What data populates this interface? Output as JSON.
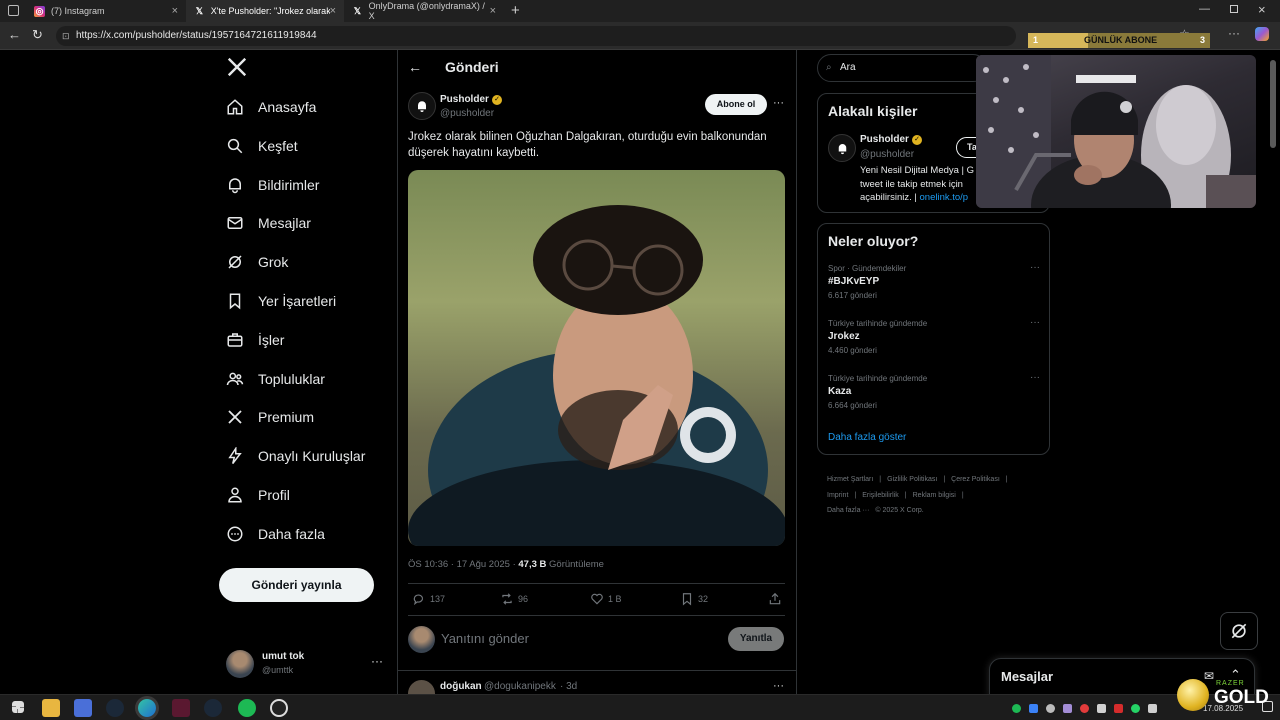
{
  "browser": {
    "tabs": [
      {
        "title": "(7) Instagram",
        "active": false
      },
      {
        "title": "X'te Pusholder: \"Jrokez olarak bili",
        "active": true
      },
      {
        "title": "OnlyDrama (@onlydramaX) / X",
        "active": false
      }
    ],
    "url": "https://x.com/pusholder/status/1957164721611919844"
  },
  "overlay": {
    "sub_goal_left": "1",
    "sub_goal_label": "GÜNLÜK ABONE",
    "sub_goal_right": "3",
    "sub_progress": 0.33,
    "gold_label": "GOLD",
    "razer_label": "RAZER"
  },
  "sidebar": {
    "items": [
      {
        "label": "Anasayfa",
        "icon": "home-icon"
      },
      {
        "label": "Keşfet",
        "icon": "search-icon"
      },
      {
        "label": "Bildirimler",
        "icon": "bell-icon"
      },
      {
        "label": "Mesajlar",
        "icon": "mail-icon"
      },
      {
        "label": "Grok",
        "icon": "grok-icon"
      },
      {
        "label": "Yer İşaretleri",
        "icon": "bookmark-icon"
      },
      {
        "label": "İşler",
        "icon": "briefcase-icon"
      },
      {
        "label": "Topluluklar",
        "icon": "people-icon"
      },
      {
        "label": "Premium",
        "icon": "x-logo-icon"
      },
      {
        "label": "Onaylı Kuruluşlar",
        "icon": "lightning-icon"
      },
      {
        "label": "Profil",
        "icon": "person-icon"
      },
      {
        "label": "Daha fazla",
        "icon": "more-circle-icon"
      }
    ],
    "post_button": "Gönderi yayınla",
    "account": {
      "name": "umut tok",
      "handle": "@umttk"
    }
  },
  "main": {
    "header_title": "Gönderi",
    "post": {
      "author_name": "Pusholder",
      "author_handle": "@pusholder",
      "follow_label": "Abone ol",
      "text": "Jrokez olarak bilinen Oğuzhan Dalgakıran, oturduğu evin balkonundan düşerek hayatını kaybetti.",
      "timestamp": "ÖS 10:36 · 17 Ağu 2025 · ",
      "views_value": "47,3 B",
      "views_label": " Görüntüleme",
      "replies": "137",
      "reposts": "96",
      "likes": "1 B",
      "bookmarks": "32"
    },
    "reply_box": {
      "placeholder": "Yanıtını gönder",
      "button": "Yanıtla"
    },
    "next_reply": {
      "name": "doğukan",
      "handle": "@dogukanipekk",
      "time": "· 3d"
    }
  },
  "right": {
    "search_placeholder": "Ara",
    "related_title": "Alakalı kişiler",
    "related": {
      "name": "Pusholder",
      "handle": "@pusholder",
      "button": "Ta",
      "bio_line1": "Yeni Nesil Dijital Medya | G",
      "bio_line2": "tweet ile takip etmek için",
      "bio_line3": "açabilirsiniz. | ",
      "bio_link": "onelink.to/p"
    },
    "trends_title": "Neler oluyor?",
    "trends": [
      {
        "category": "Spor · Gündemdekiler",
        "name": "#BJKvEYP",
        "count": "6.617 gönderi"
      },
      {
        "category": "Türkiye tarihinde gündemde",
        "name": "Jrokez",
        "count": "4.460 gönderi"
      },
      {
        "category": "Türkiye tarihinde gündemde",
        "name": "Kaza",
        "count": "6.664 gönderi"
      }
    ],
    "show_more": "Daha fazla göster",
    "footer": {
      "row1": [
        "Hizmet Şartları",
        "|",
        "Gizlilik Politikası",
        "|",
        "Çerez Politikası",
        "|"
      ],
      "row2": [
        "Imprint",
        "|",
        "Erişilebilirlik",
        "|",
        "Reklam bilgisi",
        "|"
      ],
      "row3": [
        "Daha fazla ···",
        "© 2025 X Corp."
      ]
    },
    "messages_title": "Mesajlar"
  },
  "taskbar": {
    "time": "17.08.2025"
  },
  "colors": {
    "accent": "#1d9bf0",
    "verified": "#e0b321",
    "background": "#000000",
    "border": "#2f3336"
  }
}
